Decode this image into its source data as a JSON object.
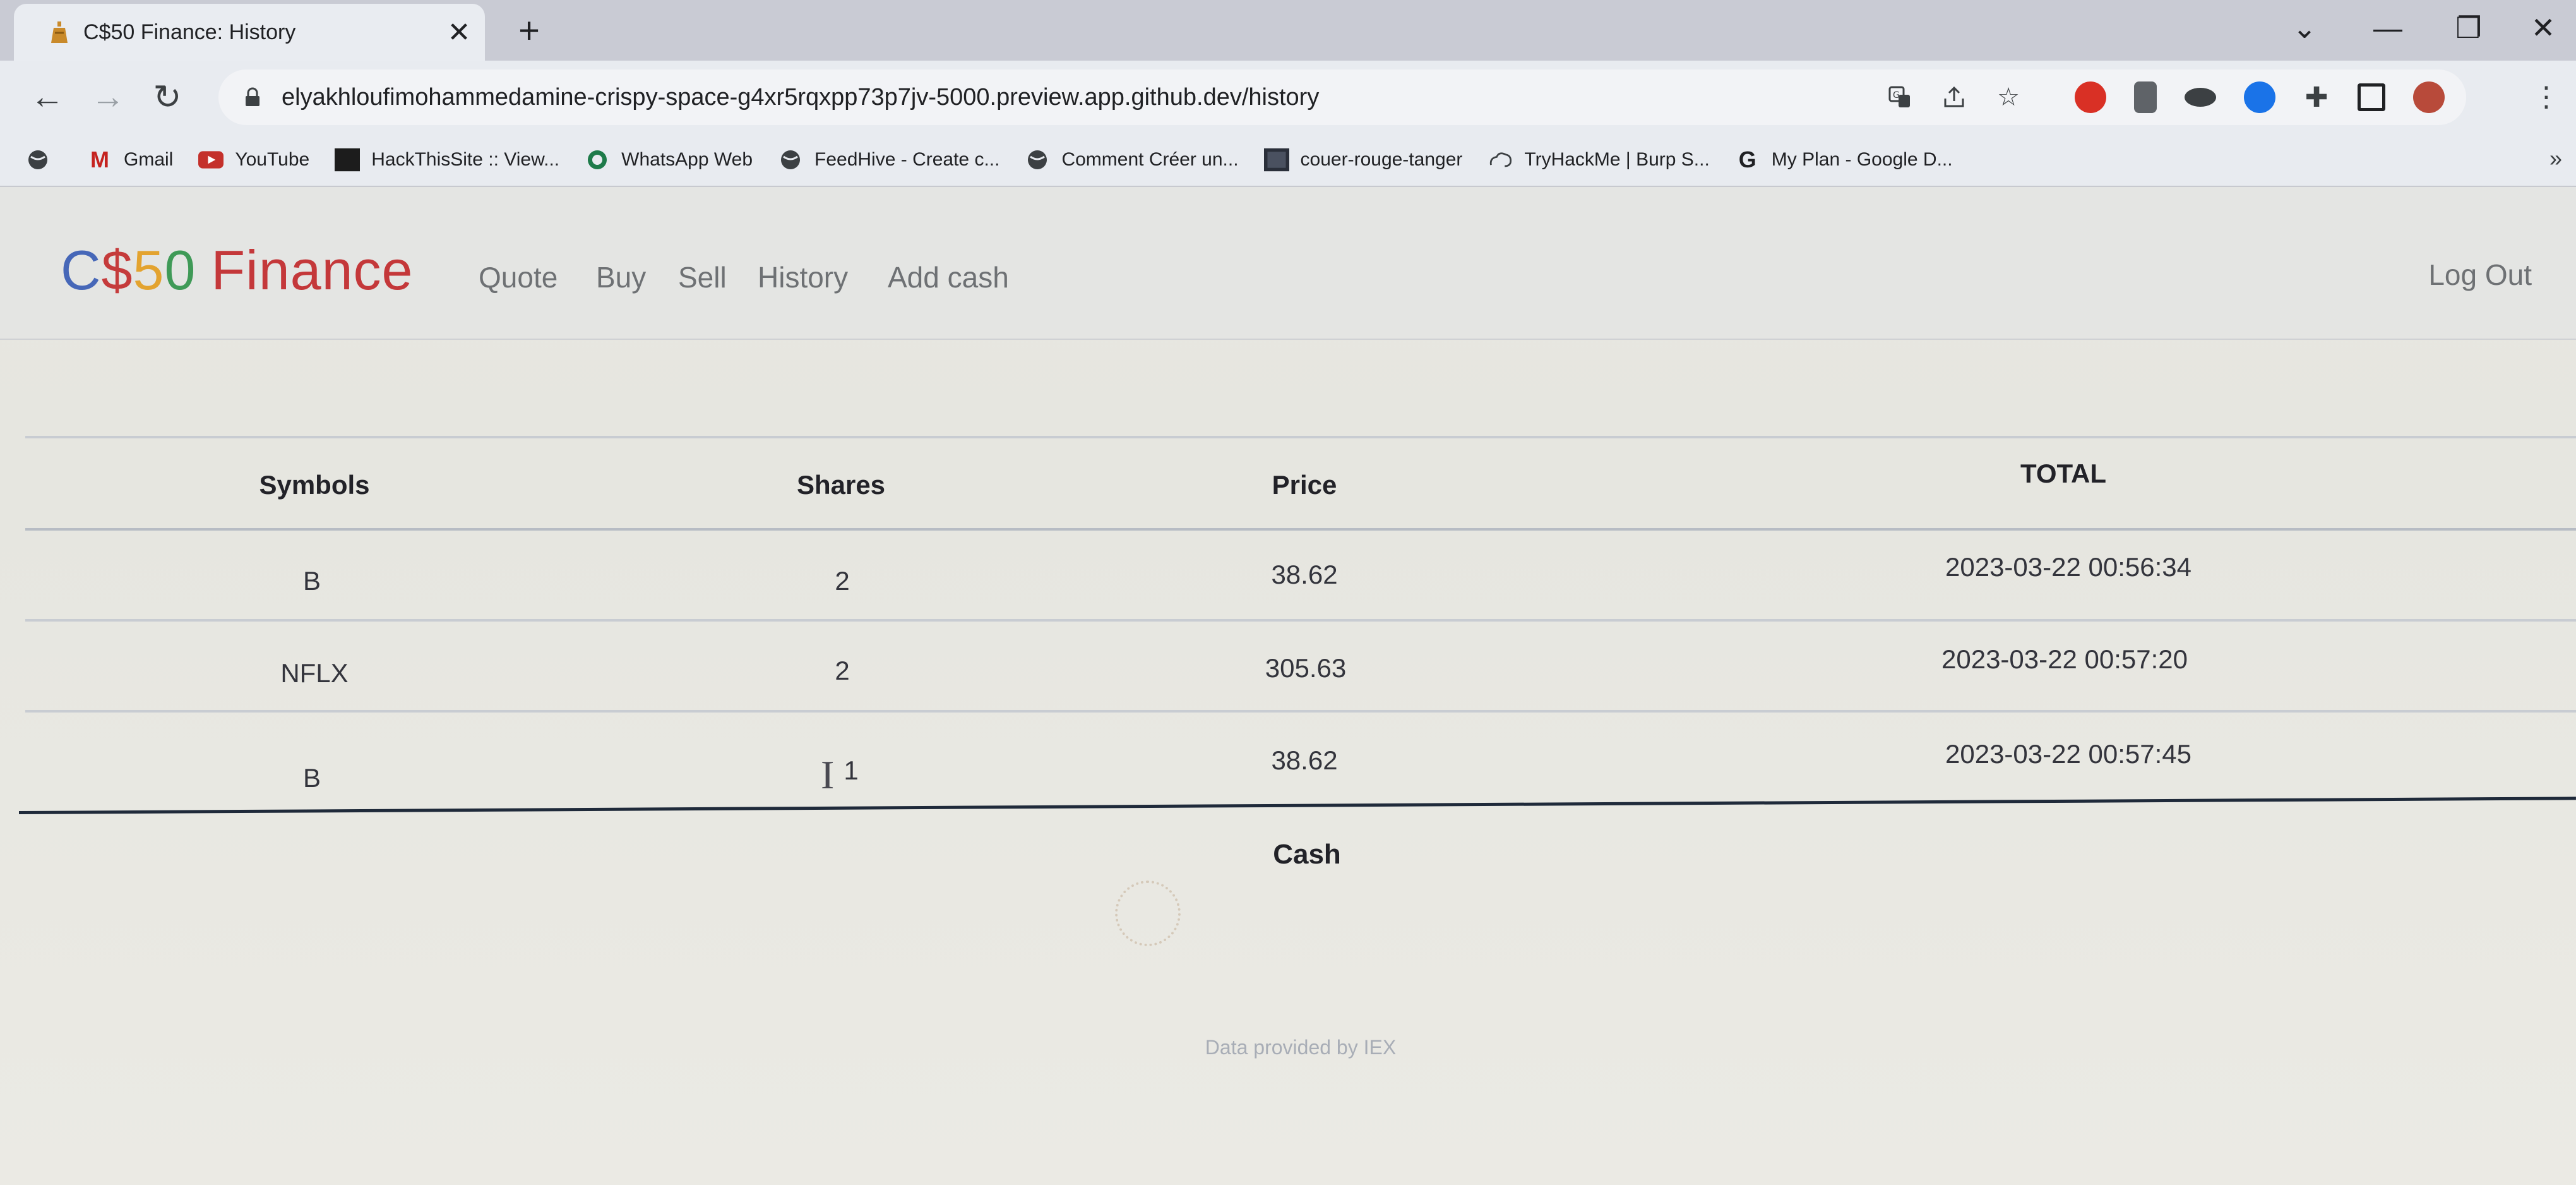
{
  "browser": {
    "tab": {
      "title": "C$50 Finance: History",
      "close": "✕"
    },
    "new_tab": "+",
    "window": {
      "dropdown": "⌄",
      "minimize": "—",
      "restore": "❐",
      "close": "✕"
    },
    "nav": {
      "back": "←",
      "forward": "→",
      "reload": "↻"
    },
    "url": "elyakhloufimohammedamine-crispy-space-g4xr5rqxpp73p7jv-5000.preview.app.github.dev/history",
    "omnibox_icons": [
      "translate-icon",
      "share-icon",
      "bookmark-star-icon"
    ],
    "extension_colors": [
      "#d93025",
      "#5f6368",
      "#3c4043",
      "#1a73e8",
      "#202124",
      "#202124",
      "#b84a3a"
    ],
    "bookmarks": [
      {
        "label": "",
        "icon": "globe-icon"
      },
      {
        "label": "Gmail",
        "icon": "gmail-icon"
      },
      {
        "label": "YouTube",
        "icon": "youtube-icon"
      },
      {
        "label": "HackThisSite :: View...",
        "icon": "hackthissite-icon"
      },
      {
        "label": "WhatsApp Web",
        "icon": "whatsapp-icon"
      },
      {
        "label": "FeedHive - Create c...",
        "icon": "globe-icon"
      },
      {
        "label": "Comment Créer un...",
        "icon": "globe-icon"
      },
      {
        "label": "couer-rouge-tanger",
        "icon": "image-icon"
      },
      {
        "label": "TryHackMe | Burp S...",
        "icon": "tryhackme-icon"
      },
      {
        "label": "My Plan - Google D...",
        "icon": "google-icon"
      }
    ],
    "bookmarks_more": "»"
  },
  "app": {
    "brand": {
      "c": "C",
      "dollar": "$",
      "five": "5",
      "zero": "0",
      "finance": "Finance"
    },
    "nav_links": [
      "Quote",
      "Buy",
      "Sell",
      "History",
      "Add cash"
    ],
    "logout": "Log Out"
  },
  "table": {
    "headers": [
      "Symbols",
      "Shares",
      "Price",
      "TOTAL"
    ],
    "rows": [
      [
        "B",
        "2",
        "38.62",
        "2023-03-22 00:56:34"
      ],
      [
        "NFLX",
        "2",
        "305.63",
        "2023-03-22 00:57:20"
      ],
      [
        "B",
        "1",
        "38.62",
        "2023-03-22 00:57:45"
      ]
    ],
    "cash_label": "Cash"
  },
  "footer": "Data provided by IEX"
}
